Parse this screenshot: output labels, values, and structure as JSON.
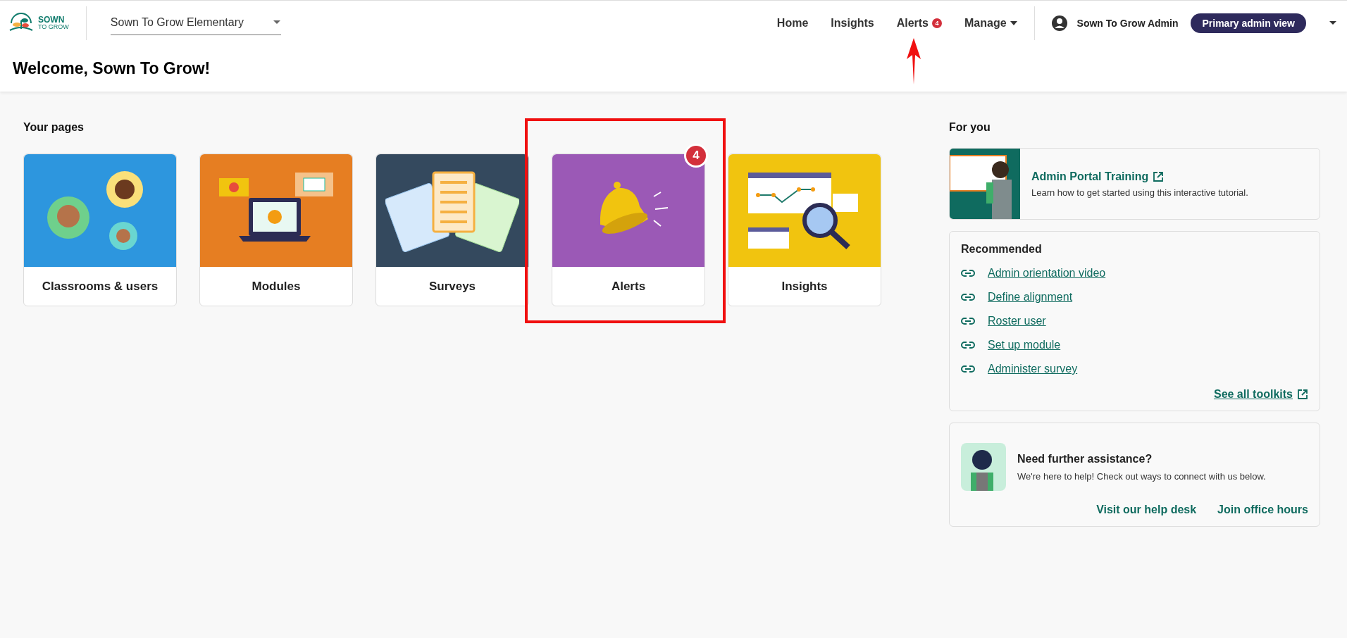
{
  "header": {
    "logo": {
      "line1": "SOWN",
      "line2": "TO GROW"
    },
    "school_select": {
      "value": "Sown To Grow Elementary"
    },
    "nav": [
      {
        "label": "Home",
        "dropdown": false,
        "pointed_at": false
      },
      {
        "label": "Insights",
        "dropdown": false,
        "pointed_at": false
      },
      {
        "label": "Alerts",
        "badge": "4",
        "dropdown": false,
        "pointed_at": true
      },
      {
        "label": "Manage",
        "dropdown": true,
        "pointed_at": false
      }
    ],
    "user": {
      "name": "Sown To Grow Admin",
      "view": "Primary admin view"
    }
  },
  "welcome": "Welcome, Sown To Grow!",
  "your_pages": {
    "title": "Your pages",
    "cards": [
      {
        "kind": "classrooms",
        "label": "Classrooms & users",
        "color": "#2d96de",
        "highlighted": false
      },
      {
        "kind": "modules",
        "label": "Modules",
        "color": "#e67e22",
        "highlighted": false
      },
      {
        "kind": "surveys",
        "label": "Surveys",
        "color": "#34495e",
        "highlighted": false
      },
      {
        "kind": "alerts",
        "label": "Alerts",
        "color": "#9b59b6",
        "badge": "4",
        "highlighted": true
      },
      {
        "kind": "insights",
        "label": "Insights",
        "color": "#f1c40f",
        "highlighted": false
      }
    ]
  },
  "for_you": {
    "title": "For you",
    "training": {
      "title": "Admin Portal Training",
      "description": "Learn how to get started using this interactive tutorial."
    },
    "recommended": {
      "title": "Recommended",
      "links": [
        "Admin orientation video",
        "Define alignment",
        "Roster user",
        "Set up module",
        "Administer survey"
      ],
      "see_all": "See all toolkits"
    },
    "assistance": {
      "title": "Need further assistance?",
      "description": "We're here to help! Check out ways to connect with us below.",
      "links": [
        "Visit our help desk",
        "Join office hours"
      ]
    }
  }
}
